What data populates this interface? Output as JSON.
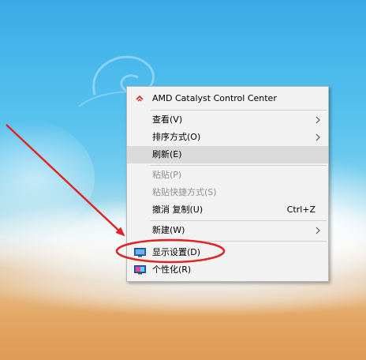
{
  "desktop": {
    "colors": {
      "sea": "#49b9ec",
      "foam": "#ffffff",
      "sand": "#e3a865"
    }
  },
  "context_menu": {
    "amd": {
      "label": "AMD Catalyst Control Center",
      "icon": "amd-logo-icon"
    },
    "view": {
      "label": "查看(V)",
      "has_submenu": true
    },
    "sort": {
      "label": "排序方式(O)",
      "has_submenu": true
    },
    "refresh": {
      "label": "刷新(E)",
      "highlighted": true
    },
    "paste": {
      "label": "粘贴(P)",
      "disabled": true
    },
    "paste_shortcut": {
      "label": "粘贴快捷方式(S)",
      "disabled": true
    },
    "undo": {
      "label": "撤消 复制(U)",
      "shortcut": "Ctrl+Z"
    },
    "new": {
      "label": "新建(W)",
      "has_submenu": true
    },
    "display": {
      "label": "显示设置(D)",
      "icon": "display-settings-icon"
    },
    "personalize": {
      "label": "个性化(R)",
      "icon": "personalize-icon"
    }
  },
  "annotation": {
    "color": "#e02424",
    "target": "display"
  }
}
